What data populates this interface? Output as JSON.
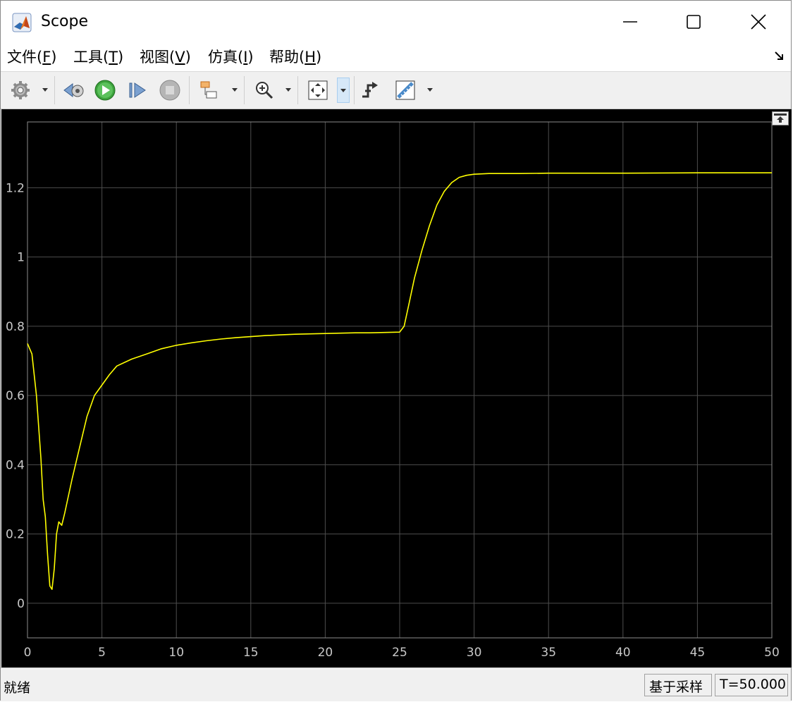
{
  "window": {
    "title": "Scope",
    "icon": "matlab-logo-icon",
    "controls": [
      "minimize-icon",
      "maximize-icon",
      "close-icon"
    ]
  },
  "menu": {
    "items": [
      {
        "label": "文件(",
        "key": "F",
        "suffix": ")"
      },
      {
        "label": "工具(",
        "key": "T",
        "suffix": ")"
      },
      {
        "label": "视图(",
        "key": "V",
        "suffix": ")"
      },
      {
        "label": "仿真(",
        "key": "I",
        "suffix": ")"
      },
      {
        "label": "帮助(",
        "key": "H",
        "suffix": ")"
      }
    ]
  },
  "toolbar": {
    "buttons": [
      "settings-gear-icon",
      "step-back-icon",
      "run-icon",
      "step-forward-icon",
      "stop-icon",
      "highlight-block-icon",
      "zoom-in-icon",
      "autoscale-icon",
      "triggers-icon",
      "measurements-icon"
    ]
  },
  "status": {
    "text": "就绪",
    "mode": "基于采样",
    "time": "T=50.000"
  },
  "colors": {
    "plot_background": "#000000",
    "grid": "#4d4d4d",
    "signal": "#ffff00",
    "tick_labels": "#c8c8c8"
  },
  "chart_data": {
    "type": "line",
    "title": "",
    "xlabel": "",
    "ylabel": "",
    "xlim": [
      0,
      50
    ],
    "ylim": [
      -0.1,
      1.39
    ],
    "xticks": [
      0,
      5,
      10,
      15,
      20,
      25,
      30,
      35,
      40,
      45,
      50
    ],
    "yticks": [
      0,
      0.2,
      0.4,
      0.6,
      0.8,
      1,
      1.2
    ],
    "xtick_labels": [
      "0",
      "5",
      "10",
      "15",
      "20",
      "25",
      "30",
      "35",
      "40",
      "45",
      "50"
    ],
    "ytick_labels": [
      "0",
      "0.2",
      "0.4",
      "0.6",
      "0.8",
      "1",
      "1.2"
    ],
    "grid": true,
    "series": [
      {
        "color": "#ffff00",
        "x": [
          0,
          0.3,
          0.6,
          0.9,
          1.05,
          1.2,
          1.35,
          1.5,
          1.65,
          1.8,
          1.95,
          2.1,
          2.3,
          2.5,
          2.7,
          3.0,
          3.5,
          4.0,
          4.5,
          5.0,
          5.5,
          6.0,
          6.5,
          7.0,
          8.0,
          9.0,
          10.0,
          11.0,
          12.0,
          13.0,
          14.0,
          15.0,
          16.0,
          17.0,
          18.0,
          19.0,
          20.0,
          21.0,
          22.0,
          23.0,
          24.0,
          25.0,
          25.3,
          25.6,
          26.0,
          26.5,
          27.0,
          27.5,
          28.0,
          28.5,
          29.0,
          29.5,
          30.0,
          30.5,
          31.0,
          32.0,
          33.0,
          35.0,
          40.0,
          45.0,
          50.0
        ],
        "y": [
          0.75,
          0.72,
          0.6,
          0.42,
          0.3,
          0.25,
          0.14,
          0.05,
          0.04,
          0.1,
          0.2,
          0.235,
          0.225,
          0.26,
          0.3,
          0.36,
          0.45,
          0.54,
          0.6,
          0.63,
          0.66,
          0.685,
          0.695,
          0.705,
          0.72,
          0.735,
          0.745,
          0.752,
          0.758,
          0.763,
          0.767,
          0.77,
          0.773,
          0.775,
          0.777,
          0.778,
          0.779,
          0.78,
          0.781,
          0.781,
          0.782,
          0.783,
          0.8,
          0.86,
          0.94,
          1.02,
          1.09,
          1.15,
          1.19,
          1.215,
          1.23,
          1.236,
          1.239,
          1.24,
          1.241,
          1.241,
          1.241,
          1.242,
          1.242,
          1.243,
          1.243
        ]
      }
    ]
  }
}
